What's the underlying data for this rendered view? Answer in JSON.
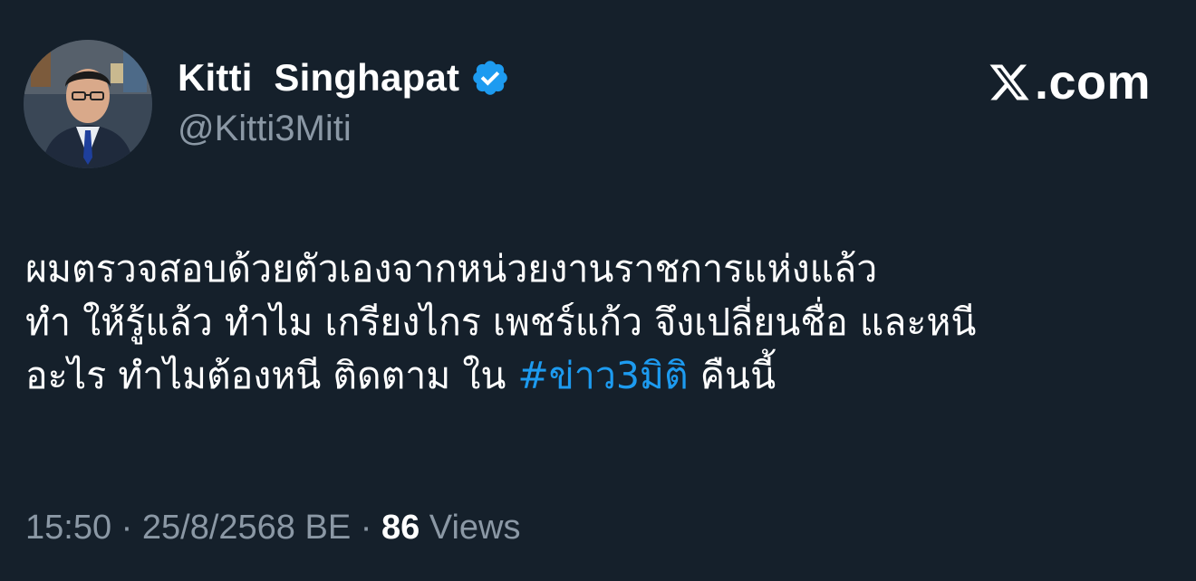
{
  "tweet": {
    "author": {
      "display_name": "Kitti  Singhapat",
      "handle": "@Kitti3Miti",
      "verified": true
    },
    "brand": {
      "label": ".com",
      "icon": "x-logo-icon"
    },
    "text_lines": [
      "ผมตรวจสอบด้วยตัวเองจากหน่วยงานราชการแห่งแล้ว",
      "ทำ ให้รู้แล้ว ทำไม เกรียงไกร เพชร์แก้ว จึงเปลี่ยนชื่อ และหนี"
    ],
    "line3_before": "อะไร ทำไมต้องหนี ติดตาม ใน ",
    "hashtag": "#ข่าว3มิติ",
    "line3_after": " คืนนี้",
    "time": "15:50",
    "separator": " · ",
    "date": "25/8/2568 BE",
    "views_count": "86",
    "views_label": " Views"
  },
  "colors": {
    "background": "#15202b",
    "text": "#ffffff",
    "secondary": "#8b98a5",
    "accent": "#1d9bf0"
  }
}
